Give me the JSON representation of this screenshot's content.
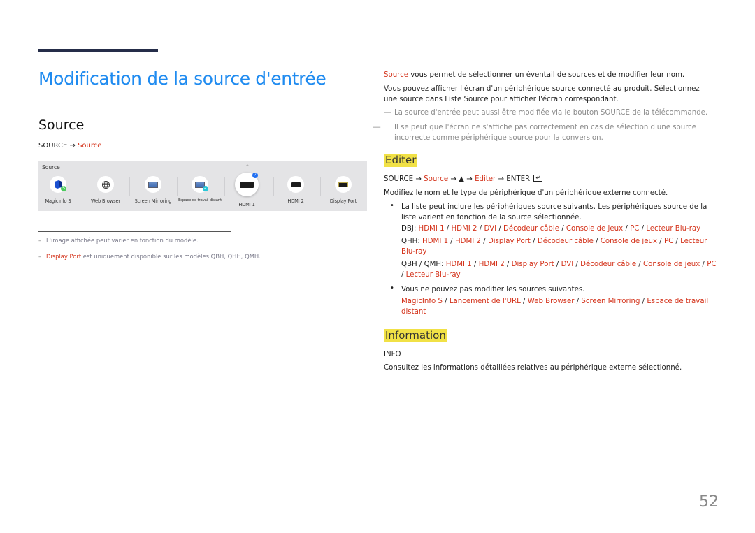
{
  "header": {
    "page_title": "Modification de la source d'entrée",
    "section_title": "Source"
  },
  "left": {
    "path": {
      "prefix": "SOURCE",
      "arrow": "→",
      "link": "Source"
    },
    "panel": {
      "label": "Source",
      "caret": "^",
      "items": [
        {
          "label": "MagicInfo S",
          "icon": "magicinfo-icon",
          "selected": false
        },
        {
          "label": "Web Browser",
          "icon": "globe-icon",
          "selected": false
        },
        {
          "label": "Screen Mirroring",
          "icon": "screen-mirroring-icon",
          "selected": false
        },
        {
          "label": "Espace de travail distant",
          "icon": "remote-workspace-icon",
          "selected": false
        },
        {
          "label": "HDMI 1",
          "icon": "hdmi-port-icon",
          "selected": true
        },
        {
          "label": "HDMI 2",
          "icon": "hdmi-port-icon",
          "selected": false
        },
        {
          "label": "Display Port",
          "icon": "displayport-icon",
          "selected": false
        }
      ]
    },
    "notes": [
      {
        "dash": "–",
        "text": "L'image affichée peut varier en fonction du modèle."
      },
      {
        "dash": "–",
        "link": "Display Port",
        "text": " est uniquement disponible sur les modèles QBH, QHH, QMH."
      }
    ]
  },
  "right": {
    "intro_link": "Source",
    "intro_text": " vous permet de sélectionner un éventail de sources et de modifier leur nom.",
    "para2": "Vous pouvez afficher l'écran d'un périphérique source connecté au produit. Sélectionnez une source dans Liste Source pour afficher l'écran correspondant.",
    "note1": "La source d'entrée peut aussi être modifiée via le bouton SOURCE de la télécommande.",
    "note2": "Il se peut que l'écran ne s'affiche pas correctement en cas de sélection d'une source incorrecte comme périphérique source pour la conversion.",
    "note_mark": "―",
    "editer": {
      "title": "Editer",
      "path": {
        "p1": "SOURCE",
        "a": "→",
        "p2": "Source",
        "p3": "▲",
        "p4": "Editer",
        "p5": "ENTER"
      },
      "desc": "Modifiez le nom et le type de périphérique d'un périphérique externe connecté.",
      "bullet1": "La liste peut inclure les périphériques source suivants. Les périphériques source de la liste varient en fonction de la source sélectionnée.",
      "models": [
        {
          "model": "DBJ:",
          "items": [
            "HDMI 1",
            "HDMI 2",
            "DVI",
            "Décodeur câble",
            "Console de jeux",
            "PC",
            "Lecteur Blu-ray"
          ]
        },
        {
          "model": "QHH:",
          "items": [
            "HDMI 1",
            "HDMI 2",
            "Display Port",
            "Décodeur câble",
            "Console de jeux",
            "PC",
            "Lecteur Blu-ray"
          ]
        },
        {
          "model": "QBH / QMH:",
          "items": [
            "HDMI 1",
            "HDMI 2",
            "Display Port",
            "DVI",
            "Décodeur câble",
            "Console de jeux",
            "PC",
            "Lecteur Blu-ray"
          ]
        }
      ],
      "bullet2": "Vous ne pouvez pas modifier les sources suivantes.",
      "fixed_sources": [
        "MagicInfo S",
        "Lancement de l'URL",
        "Web Browser",
        "Screen Mirroring",
        "Espace de travail distant"
      ],
      "bullet_mark": "•"
    },
    "information": {
      "title": "Information",
      "path": "INFO",
      "desc": "Consultez les informations détaillées relatives au périphérique externe sélectionné."
    }
  },
  "footer": {
    "page_number": "52"
  },
  "colors": {
    "accent_blue": "#1f8bf0",
    "link_red": "#d4331b",
    "highlight_yellow": "#f1e146"
  }
}
